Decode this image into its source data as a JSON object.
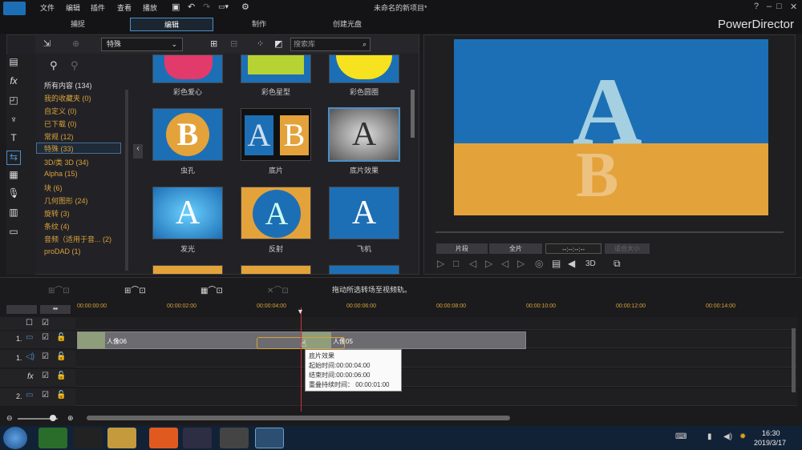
{
  "menu": {
    "items": [
      "文件",
      "编辑",
      "插件",
      "查看",
      "播放"
    ],
    "title": "未命名的新项目*"
  },
  "tabs": [
    {
      "label": "捕捉"
    },
    {
      "label": "编辑"
    },
    {
      "label": "制作"
    },
    {
      "label": "创建光盘"
    }
  ],
  "brand": "PowerDirector",
  "library": {
    "filter": "特殊",
    "search_placeholder": "搜索库",
    "categories": [
      {
        "label": "所有内容 (134)"
      },
      {
        "label": "我的收藏夹 (0)"
      },
      {
        "label": "自定义 (0)"
      },
      {
        "label": "已下载 (0)"
      },
      {
        "label": "常规 (12)"
      },
      {
        "label": "特殊 (33)"
      },
      {
        "label": "3D/类 3D (34)"
      },
      {
        "label": "Alpha (15)"
      },
      {
        "label": "块 (6)"
      },
      {
        "label": "几何图形 (24)"
      },
      {
        "label": "旋转 (3)"
      },
      {
        "label": "条纹 (4)"
      },
      {
        "label": "音频（适用于音... (2)"
      },
      {
        "label": "proDAD (1)"
      }
    ],
    "thumbs_row1": [
      "彩色爱心",
      "彩色星型",
      "彩色圆圈"
    ],
    "thumbs_row2": [
      "虫孔",
      "底片",
      "底片效果"
    ],
    "thumbs_row3": [
      "发光",
      "反射",
      "飞机"
    ],
    "thumb_letters": {
      "b": "B",
      "a": "A"
    }
  },
  "preview": {
    "btn_clip": "片段",
    "btn_full": "全片",
    "timecode": "--:--:--:--",
    "fit": "适合大小",
    "threed": "3D"
  },
  "timeline_toolbar": {
    "hint": "拖动所选转场至视频轨。"
  },
  "ruler": [
    "00:00:00:00",
    "00:00:02:00",
    "00:00:04:00",
    "00:00:06:00",
    "00:00:08:00",
    "00:00:10:00",
    "00:00:12:00",
    "00:00:14:00"
  ],
  "tracks": {
    "t1": "1.",
    "fx": "fx",
    "t2": "2."
  },
  "clips": {
    "c1": "人像06",
    "c2": "人像05"
  },
  "tooltip": {
    "name": "底片效果",
    "start": "起始时间:00:00:04:00",
    "end": "结束时间:00:00:06:00",
    "overlap": "重叠持续时间： 00:00:01:00"
  },
  "taskbar": {
    "time": "16:30",
    "date": "2019/3/17"
  },
  "colors": {
    "accent": "#4a8fc9",
    "category": "#d9a13a",
    "preview_sky": "#1d6fb5",
    "preview_sand": "#e4a23b"
  }
}
